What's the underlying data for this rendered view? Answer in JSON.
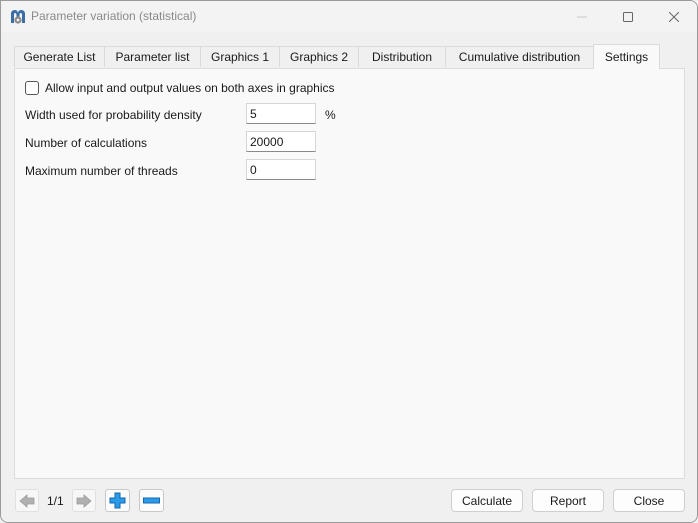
{
  "window": {
    "title": "Parameter variation (statistical)",
    "controls": {
      "minimize": "minimize",
      "maximize": "maximize",
      "close": "close"
    }
  },
  "tabs": [
    {
      "label": "Generate List",
      "active": false
    },
    {
      "label": "Parameter list",
      "active": false
    },
    {
      "label": "Graphics 1",
      "active": false
    },
    {
      "label": "Graphics 2",
      "active": false
    },
    {
      "label": "Distribution",
      "active": false
    },
    {
      "label": "Cumulative distribution",
      "active": false
    },
    {
      "label": "Settings",
      "active": true
    }
  ],
  "settings": {
    "allow_both_axes": {
      "label": "Allow input and output values on both axes in graphics",
      "checked": false
    },
    "prob_density_width": {
      "label": "Width used for probability density",
      "value": "5",
      "unit": "%"
    },
    "num_calculations": {
      "label": "Number of calculations",
      "value": "20000"
    },
    "max_threads": {
      "label": "Maximum number of threads",
      "value": "0"
    }
  },
  "bottom": {
    "page_counter": "1/1",
    "calculate_label": "Calculate",
    "report_label": "Report",
    "close_label": "Close"
  },
  "colors": {
    "accent_blue": "#1e90e6",
    "nav_arrow_gray": "#a8a8a8"
  }
}
